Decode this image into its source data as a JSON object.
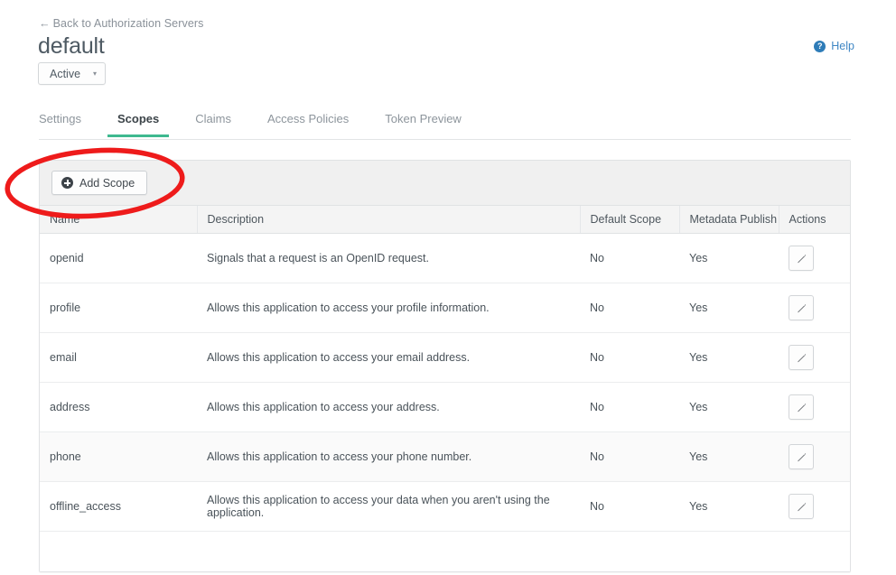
{
  "header": {
    "back_link": "Back to Authorization Servers",
    "back_arrow": "←",
    "title": "default",
    "status_label": "Active",
    "status_caret": "▾",
    "help_label": "Help",
    "help_icon_glyph": "?"
  },
  "tabs": [
    {
      "label": "Settings",
      "active": false
    },
    {
      "label": "Scopes",
      "active": true
    },
    {
      "label": "Claims",
      "active": false
    },
    {
      "label": "Access Policies",
      "active": false
    },
    {
      "label": "Token Preview",
      "active": false
    }
  ],
  "toolbar": {
    "add_scope_label": "Add Scope"
  },
  "table": {
    "columns": [
      "Name",
      "Description",
      "Default Scope",
      "Metadata Publish",
      "Actions"
    ],
    "rows": [
      {
        "name": "openid",
        "description": "Signals that a request is an OpenID request.",
        "default_scope": "No",
        "metadata_publish": "Yes",
        "highlighted": false
      },
      {
        "name": "profile",
        "description": "Allows this application to access your profile information.",
        "default_scope": "No",
        "metadata_publish": "Yes",
        "highlighted": false
      },
      {
        "name": "email",
        "description": "Allows this application to access your email address.",
        "default_scope": "No",
        "metadata_publish": "Yes",
        "highlighted": false
      },
      {
        "name": "address",
        "description": "Allows this application to access your address.",
        "default_scope": "No",
        "metadata_publish": "Yes",
        "highlighted": false
      },
      {
        "name": "phone",
        "description": "Allows this application to access your phone number.",
        "default_scope": "No",
        "metadata_publish": "Yes",
        "highlighted": true
      },
      {
        "name": "offline_access",
        "description": "Allows this application to access your data when you aren't using the application.",
        "default_scope": "No",
        "metadata_publish": "Yes",
        "highlighted": false
      }
    ]
  },
  "annotation": {
    "shape": "ellipse",
    "color": "#ee1b1b",
    "target": "Add Scope"
  },
  "colors": {
    "accent_tab_underline": "#3fb990",
    "link_blue": "#3f87c4",
    "annotation_red": "#ee1b1b",
    "toolbar_bg": "#f0f0f0",
    "table_header_bg": "#f4f4f4",
    "row_highlight_bg": "#fafafa"
  }
}
